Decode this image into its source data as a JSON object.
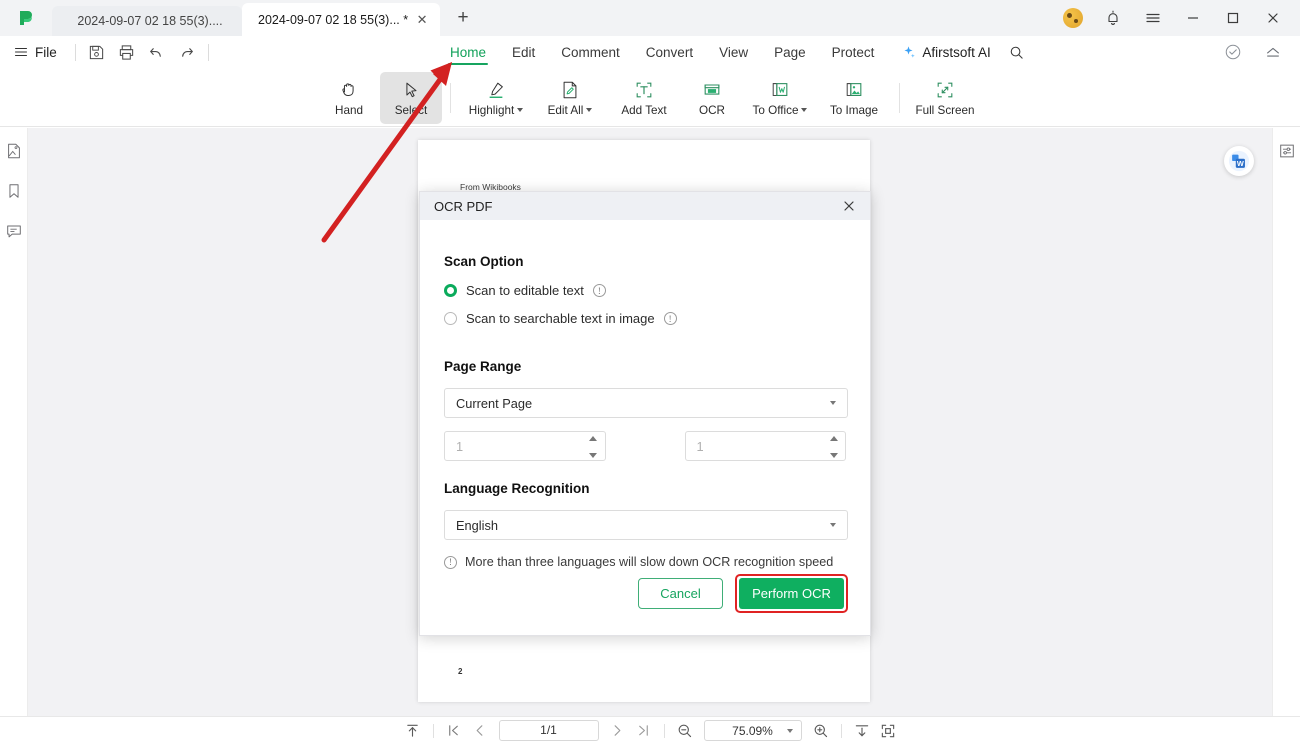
{
  "window": {
    "tabs": [
      {
        "label": "2024-09-07 02 18 55(3)....",
        "active": false,
        "modified": false
      },
      {
        "label": "2024-09-07 02 18 55(3)... *",
        "active": true,
        "modified": true
      }
    ],
    "new_tab_label": "+",
    "controls": {
      "avatar": "user-avatar",
      "notifications": "bell-icon",
      "menu": "hamburger-icon",
      "minimize": "—",
      "maximize": "□",
      "close": "✕"
    }
  },
  "menubar": {
    "file_label": "File",
    "quick_actions": [
      {
        "name": "save-icon",
        "title": "Save"
      },
      {
        "name": "print-icon",
        "title": "Print"
      },
      {
        "name": "undo-icon",
        "title": "Undo"
      },
      {
        "name": "redo-icon",
        "title": "Redo"
      }
    ],
    "tabs": [
      {
        "label": "Home",
        "active": true
      },
      {
        "label": "Edit",
        "active": false
      },
      {
        "label": "Comment",
        "active": false
      },
      {
        "label": "Convert",
        "active": false
      },
      {
        "label": "View",
        "active": false
      },
      {
        "label": "Page",
        "active": false
      },
      {
        "label": "Protect",
        "active": false
      }
    ],
    "ai_label": "Afirstsoft AI",
    "search_icon": "search-icon",
    "right_icons": [
      {
        "name": "cloud-check-icon"
      },
      {
        "name": "collapse-ribbon-icon"
      }
    ]
  },
  "ribbon": {
    "items": [
      {
        "label": "Hand",
        "icon": "hand-icon",
        "dropdown": false,
        "selected": false
      },
      {
        "label": "Select",
        "icon": "cursor-icon",
        "dropdown": false,
        "selected": true
      },
      {
        "label": "Highlight",
        "icon": "highlighter-icon",
        "dropdown": true,
        "selected": false
      },
      {
        "label": "Edit All",
        "icon": "edit-page-icon",
        "dropdown": true,
        "selected": false
      },
      {
        "label": "Add Text",
        "icon": "add-text-icon",
        "dropdown": false,
        "selected": false
      },
      {
        "label": "OCR",
        "icon": "ocr-icon",
        "dropdown": false,
        "selected": false,
        "highlighted": true
      },
      {
        "label": "To Office",
        "icon": "to-office-icon",
        "dropdown": true,
        "selected": false
      },
      {
        "label": "To Image",
        "icon": "to-image-icon",
        "dropdown": false,
        "selected": false
      },
      {
        "label": "Full Screen",
        "icon": "full-screen-icon",
        "dropdown": false,
        "selected": false
      }
    ],
    "highlight_color": "#e02323"
  },
  "left_rail": [
    {
      "name": "thumbnails-icon"
    },
    {
      "name": "bookmark-icon"
    },
    {
      "name": "comment-icon"
    }
  ],
  "right_rail": [
    {
      "name": "properties-panel-icon"
    }
  ],
  "document": {
    "top_text": "From Wikibooks",
    "page_number_text": "2",
    "convert_fab": "word-convert-icon"
  },
  "dialog": {
    "title": "OCR PDF",
    "close_icon": "close-icon",
    "scan_option": {
      "heading": "Scan Option",
      "options": [
        {
          "label": "Scan to editable text",
          "selected": true,
          "info": "info-icon"
        },
        {
          "label": "Scan to searchable text in image",
          "selected": false,
          "info": "info-icon"
        }
      ]
    },
    "page_range": {
      "heading": "Page Range",
      "select_value": "Current Page",
      "from_value": "1",
      "to_value": "1"
    },
    "language": {
      "heading": "Language Recognition",
      "select_value": "English",
      "note": "More than three languages will slow down OCR recognition speed",
      "note_icon": "info-icon"
    },
    "buttons": {
      "cancel": "Cancel",
      "perform": "Perform OCR",
      "perform_color": "#0faf60",
      "highlight_color": "#e02323"
    }
  },
  "statusbar": {
    "fit_top_icon": "scroll-to-top-icon",
    "first_page_icon": "first-page-icon",
    "prev_page_icon": "previous-page-icon",
    "page_value": "1/1",
    "next_page_icon": "next-page-icon",
    "last_page_icon": "last-page-icon",
    "zoom_out_icon": "zoom-out-icon",
    "zoom_value": "75.09%",
    "zoom_in_icon": "zoom-in-icon",
    "fit_width_icon": "fit-width-icon",
    "fit_page_icon": "fit-page-icon"
  },
  "annotation": {
    "arrow_color": "#d32121",
    "arrow_from": "324,240",
    "arrow_to": "452,63"
  }
}
